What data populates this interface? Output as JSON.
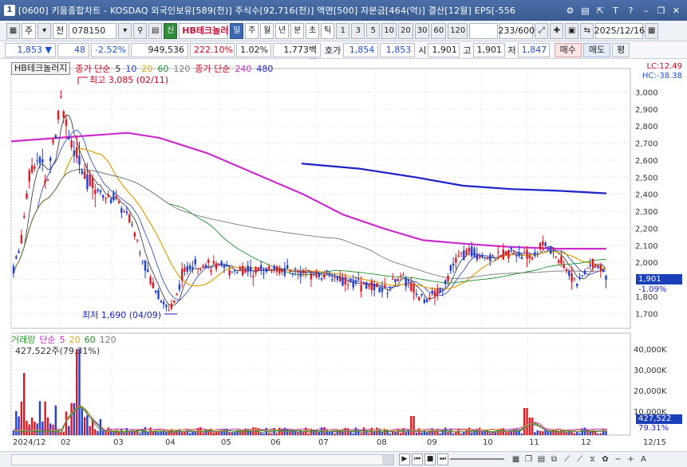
{
  "window": {
    "number": "1",
    "title": "[0600] 키움종합차트 - KOSDAQ 외국인보유[589(천)] 주식수[92,716(천)] 액면[500] 자본금[464(억)] 결산[12월] EPS[-556",
    "icons": [
      "settings-icon",
      "window-icon",
      "pin-icon",
      "text-icon",
      "help-icon",
      "minimize-icon",
      "restore-icon",
      "close-icon"
    ],
    "icon_glyphs": [
      "⚙",
      "▤",
      "⇱",
      "T",
      "?",
      "–",
      "❐",
      "✕"
    ]
  },
  "toolbar": {
    "period_type": "주",
    "prev_label": "전",
    "stock_code": "078150",
    "credit_label": "신",
    "stock_name": "HB테크놀러",
    "period_buttons": [
      "일",
      "주",
      "월",
      "년",
      "분",
      "초",
      "틱"
    ],
    "active_period": "일",
    "interval_buttons": [
      "1",
      "3",
      "5",
      "10",
      "20",
      "30",
      "60",
      "120"
    ],
    "count": "233/600",
    "date": "2025/12/16"
  },
  "quote": {
    "price": "1,853",
    "direction": "▼",
    "change": "48",
    "change_pct": "-2.52%",
    "volume": "949,536",
    "volume_ratio": "222.10%",
    "turnover": "1.02%",
    "amount": "1,773백만",
    "bid_label": "호가",
    "bid": "1,854",
    "ask": "1,853",
    "open_label": "시",
    "open": "1,901",
    "high_label": "고",
    "high": "1,901",
    "low_label": "저",
    "low": "1,847",
    "sell_button": "매수",
    "buy_button": "매도",
    "flat_button": "평"
  },
  "legend": {
    "stock_box": "HB테크놀러지",
    "ma_label": "종가 단순",
    "ma_periods": [
      "5",
      "10",
      "20",
      "60",
      "120"
    ],
    "ma_colors": [
      "#2b2b2b",
      "#1d3ec9",
      "#e0a516",
      "#1e8f2a",
      "#7a7a7a"
    ],
    "ma2_label": "종가 단순",
    "ma2_periods": [
      "240",
      "480"
    ],
    "ma2_colors": [
      "#cc2ccc",
      "#1a22c8"
    ],
    "lc": "LC:12.49",
    "hc": "HC:-38.38"
  },
  "annotations": {
    "high_label": "최고 3,085 (02/11)",
    "low_label": "최저 1,690 (04/09)"
  },
  "price_axis": {
    "ticks": [
      "3,000",
      "2,900",
      "2,800",
      "2,700",
      "2,600",
      "2,500",
      "2,400",
      "2,300",
      "2,200",
      "2,100",
      "2,000",
      "1,900",
      "1,800",
      "1,700"
    ],
    "current_price": "1,901",
    "current_pct": "-1.09%"
  },
  "volume": {
    "label": "거래량",
    "ma_label": "단순",
    "ma_periods": [
      "5",
      "20",
      "60",
      "120"
    ],
    "ma_colors": [
      "#c030c0",
      "#e0a516",
      "#1e8f2a",
      "#7a7a7a"
    ],
    "current": "427,522주(79.31%)",
    "axis_ticks": [
      "40,000K",
      "30,000K",
      "20,000K",
      "10,000K"
    ],
    "tag_value": "427,522",
    "tag_pct": "79.31%"
  },
  "time_axis": {
    "labels": [
      "2024/12",
      "02",
      "03",
      "04",
      "05",
      "06",
      "07",
      "08",
      "09",
      "10",
      "11",
      "12"
    ],
    "right_label": "12/15"
  },
  "chart_data": {
    "type": "candlestick",
    "ylim": [
      1650,
      3100
    ],
    "series_ma240": "magenta long-term moving average",
    "annotations": [
      "최고 3,085 (02/11)",
      "최저 1,690 (04/09)"
    ],
    "last_close": 1901,
    "high": 3085,
    "low": 1690,
    "y_ticks": [
      1700,
      1800,
      1900,
      2000,
      2100,
      2200,
      2300,
      2400,
      2500,
      2600,
      2700,
      2800,
      2900,
      3000
    ]
  }
}
